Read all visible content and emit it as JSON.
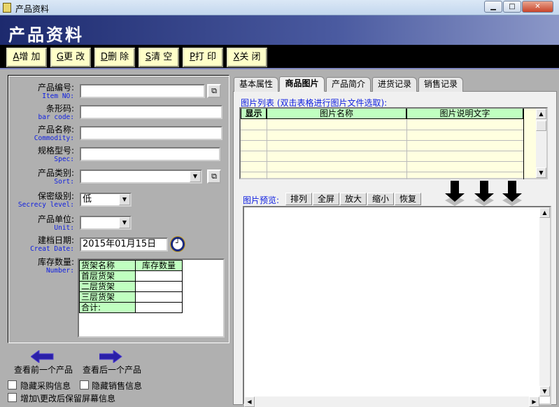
{
  "window": {
    "title": "产品资料",
    "minimize": "▁",
    "maximize": "□",
    "close": "✕"
  },
  "header": {
    "title": "产品资料"
  },
  "toolbar": [
    {
      "key": "A",
      "label": "增 加"
    },
    {
      "key": "G",
      "label": "更 改"
    },
    {
      "key": "D",
      "label": "删 除"
    },
    {
      "key": "S",
      "label": "清 空"
    },
    {
      "key": "P",
      "label": "打 印"
    },
    {
      "key": "X",
      "label": "关 闭"
    }
  ],
  "form": {
    "item_no": {
      "label": "产品编号:",
      "en": "Item NO:",
      "value": ""
    },
    "barcode": {
      "label": "条形码:",
      "en": "bar code:",
      "value": ""
    },
    "commodity": {
      "label": "产品名称:",
      "en": "Commodity:",
      "value": ""
    },
    "spec": {
      "label": "规格型号:",
      "en": "Spec:",
      "value": ""
    },
    "sort": {
      "label": "产品类别:",
      "en": "Sort:",
      "value": ""
    },
    "secrecy": {
      "label": "保密级别:",
      "en": "Secrecy level:",
      "value": "低"
    },
    "unit": {
      "label": "产品单位:",
      "en": "Unit:",
      "value": ""
    },
    "create_date": {
      "label": "建档日期:",
      "en": "Creat Date:",
      "value": "2015年01月15日"
    },
    "number": {
      "label": "库存数量:",
      "en": "Number:"
    }
  },
  "stock_table": {
    "headers": [
      "货架名称",
      "库存数量"
    ],
    "rows": [
      [
        "首层货架",
        ""
      ],
      [
        "二层货架",
        ""
      ],
      [
        "三层货架",
        ""
      ],
      [
        "合计:",
        ""
      ]
    ]
  },
  "nav": {
    "prev": "查看前一个产品",
    "next": "查看后一个产品"
  },
  "checkboxes": [
    {
      "label": "隐藏采购信息",
      "checked": false
    },
    {
      "label": "隐藏销售信息",
      "checked": false
    },
    {
      "label": "增加\\更改后保留屏幕信息",
      "checked": false
    }
  ],
  "tabs": [
    {
      "label": "基本属性",
      "active": false
    },
    {
      "label": "商品图片",
      "active": true
    },
    {
      "label": "产品简介",
      "active": false
    },
    {
      "label": "进货记录",
      "active": false
    },
    {
      "label": "销售记录",
      "active": false
    }
  ],
  "picture": {
    "list_label": "图片列表 (双击表格进行图片文件选取):",
    "columns": [
      "显示",
      "图片名称",
      "图片说明文字"
    ],
    "preview_label": "图片预览:",
    "preview_buttons": [
      "排列",
      "全屏",
      "放大",
      "缩小",
      "恢复"
    ]
  }
}
